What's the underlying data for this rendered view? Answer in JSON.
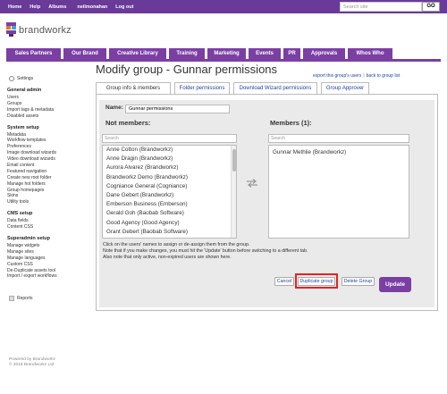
{
  "topbar": {
    "links": [
      "Home",
      "Help",
      "Albums",
      "neilmonahan",
      "Log out"
    ],
    "search_placeholder": "Search site",
    "go_label": "GO"
  },
  "brand": {
    "name": "brandworkz"
  },
  "nav": {
    "items": [
      "Sales Partners",
      "Our Brand",
      "Creative Library",
      "Training",
      "Marketing",
      "Events",
      "PR",
      "Approvals",
      "Whos Who"
    ]
  },
  "sidebar": {
    "settings_label": "Settings",
    "sections": [
      {
        "heading": "General admin",
        "items": [
          "Users",
          "Groups",
          "Import tags & metadata",
          "Disabled assets"
        ]
      },
      {
        "heading": "System setup",
        "items": [
          "Metadata",
          "Workflow templates",
          "Preferences",
          "Image download wizards",
          "Video download wizards",
          "Email content",
          "Featured navigation",
          "Create new root folder",
          "Manage hot folders",
          "Group homepages",
          "Skins",
          "Utility tools"
        ]
      },
      {
        "heading": "CMS setup",
        "items": [
          "Data fields",
          "Content CSS"
        ]
      },
      {
        "heading": "Superadmin setup",
        "items": [
          "Manage widgets",
          "Manage sites",
          "Manage languages",
          "Custom CSS",
          "De-Duplicate assets tool",
          "Import / export workflows"
        ]
      }
    ],
    "reports_label": "Reports"
  },
  "footer": {
    "line1": "Powered by Brandworkz",
    "line2": "© 2016 Brandworkz Ltd"
  },
  "page": {
    "title": "Modify group - Gunnar permissions",
    "export_link": "export this group's users",
    "separator": "|",
    "back_link": "back to group list"
  },
  "tabs": [
    "Group info & members",
    "Folder permissions",
    "Download Wizard permissions",
    "Group Approver"
  ],
  "form": {
    "name_label": "Name:",
    "name_value": "Gunnar permissions",
    "not_members_label": "Not members:",
    "members_label": "Members (1):",
    "search_placeholder": "Search",
    "not_members": [
      "Anne Cotton (Brandworkz)",
      "Anne Dragin (Brandworkz)",
      "Aurora Alvarez (Brandworkz)",
      "Brandworkz Demo (Brandworkz)",
      "Cogniance General (Cogniance)",
      "Dane Gebert (Brandworkz)",
      "Emberson Business (Emberson)",
      "Gerald Goh (Baobab Software)",
      "Good Agency (Good Agency)",
      "Grant Gebert (Baobab Software)"
    ],
    "members": [
      "Gunnar Methlie (Brandworkz)"
    ],
    "help_lines": [
      "Click on the users' names to assign or de-assign them from the group.",
      "Note that if you make changes, you must hit the 'Update' button before switching to a different tab.",
      "Also note that only active, non-expired users are shown here."
    ]
  },
  "buttons": {
    "cancel": "Cancel",
    "duplicate": "Duplicate group",
    "delete": "Delete Group",
    "update": "Update"
  },
  "colors": {
    "brand_purple": "#7b3fa4",
    "topbar": "#6a3a98",
    "link": "#224499",
    "highlight": "#e8211e"
  }
}
